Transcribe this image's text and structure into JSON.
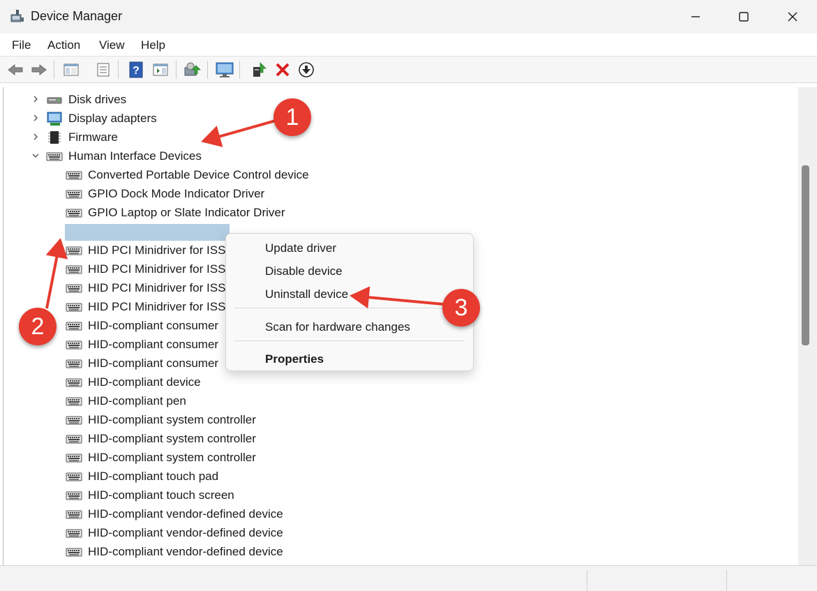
{
  "window": {
    "title": "Device Manager",
    "controls": {
      "minimize": "minimize-icon",
      "maximize": "maximize-icon",
      "close": "close-icon"
    }
  },
  "menu": [
    "File",
    "Action",
    "View",
    "Help"
  ],
  "toolbar": {
    "buttons": [
      "back-arrow-icon",
      "forward-arrow-icon",
      "show-hide-console-tree-icon",
      "properties-icon",
      "help-icon",
      "action-pane-icon",
      "scan-hardware-icon",
      "monitor-icon",
      "update-driver-icon",
      "uninstall-icon",
      "download-icon"
    ]
  },
  "tree": {
    "categories": [
      {
        "label": "Disk drives",
        "expanded": false,
        "icon": "disk-drive-icon"
      },
      {
        "label": "Display adapters",
        "expanded": false,
        "icon": "display-adapter-icon"
      },
      {
        "label": "Firmware",
        "expanded": false,
        "icon": "firmware-chip-icon"
      },
      {
        "label": "Human Interface Devices",
        "expanded": true,
        "icon": "hid-icon"
      }
    ],
    "hid_children": [
      "Converted Portable Device Control device",
      "GPIO Dock Mode Indicator Driver",
      "GPIO Laptop or Slate Indicator Driver",
      "",
      "HID PCI Minidriver for ISS",
      "HID PCI Minidriver for ISS",
      "HID PCI Minidriver for ISS",
      "HID PCI Minidriver for ISS",
      "HID-compliant consumer",
      "HID-compliant consumer",
      "HID-compliant consumer",
      "HID-compliant device",
      "HID-compliant pen",
      "HID-compliant system controller",
      "HID-compliant system controller",
      "HID-compliant system controller",
      "HID-compliant touch pad",
      "HID-compliant touch screen",
      "HID-compliant vendor-defined device",
      "HID-compliant vendor-defined device",
      "HID-compliant vendor-defined device"
    ]
  },
  "context_menu": {
    "items": [
      "Update driver",
      "Disable device",
      "Uninstall device",
      "Scan for hardware changes",
      "Properties"
    ]
  },
  "annotations": {
    "badges": [
      "1",
      "2",
      "3"
    ],
    "color": "#e63b2e"
  },
  "colors": {
    "selection": "#b3cde3",
    "titlebar": "#f3f3f3"
  }
}
